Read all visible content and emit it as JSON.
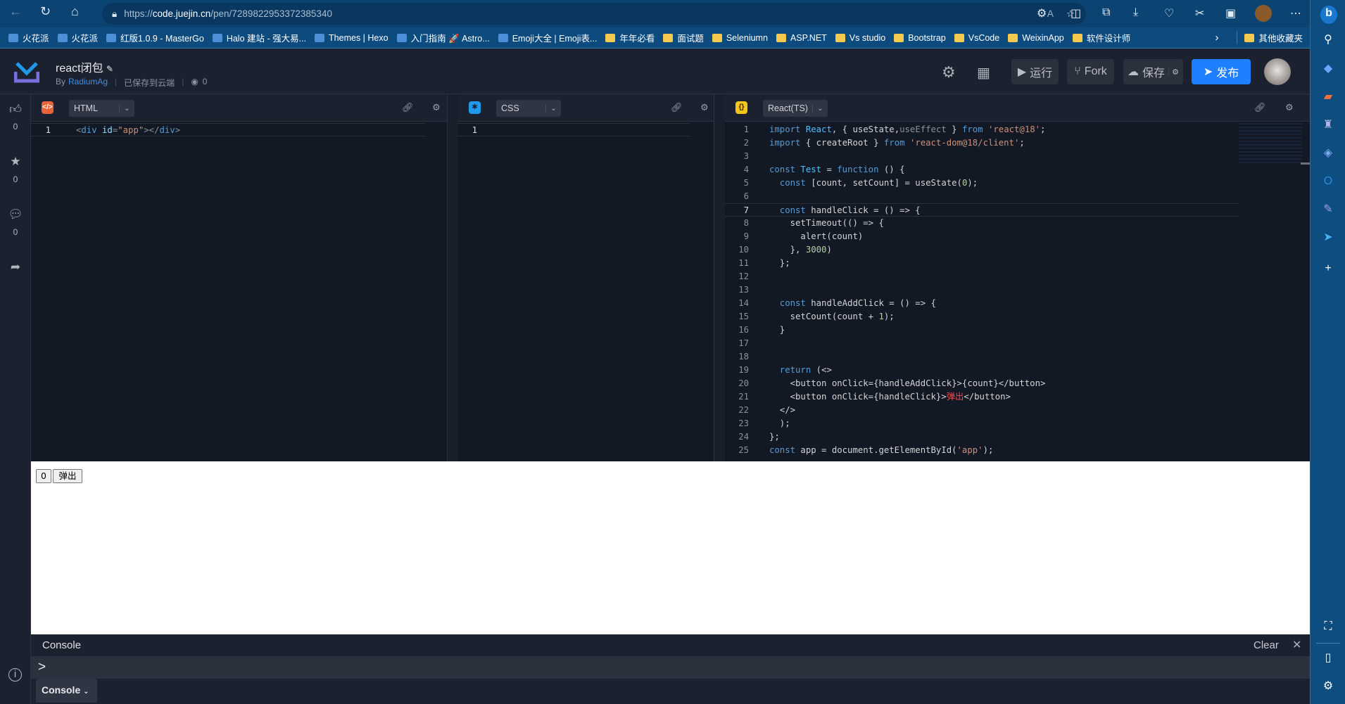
{
  "browser": {
    "url_prefix": "https://",
    "url_host": "code.juejin.cn",
    "url_path": "/pen/7289822953372385340",
    "bookmarks": [
      {
        "label": "火花派",
        "icon": "site"
      },
      {
        "label": "火花派",
        "icon": "site"
      },
      {
        "label": "红版1.0.9 - MasterGo",
        "icon": "site"
      },
      {
        "label": "Halo 建站 - 强大易...",
        "icon": "site"
      },
      {
        "label": "Themes | Hexo",
        "icon": "site"
      },
      {
        "label": "入门指南 🚀 Astro...",
        "icon": "site"
      },
      {
        "label": "Emoji大全 | Emoji表...",
        "icon": "site"
      },
      {
        "label": "年年必看",
        "icon": "folder"
      },
      {
        "label": "面试题",
        "icon": "folder"
      },
      {
        "label": "Seleniumn",
        "icon": "folder"
      },
      {
        "label": "ASP.NET",
        "icon": "folder"
      },
      {
        "label": "Vs studio",
        "icon": "folder"
      },
      {
        "label": "Bootstrap",
        "icon": "folder"
      },
      {
        "label": "VsCode",
        "icon": "folder"
      },
      {
        "label": "WeixinApp",
        "icon": "folder"
      },
      {
        "label": "软件设计师",
        "icon": "folder"
      }
    ],
    "other_bookmarks": "其他收藏夹"
  },
  "header": {
    "title": "react闭包",
    "by": "By",
    "author": "RadiumAg",
    "save_status": "已保存到云端",
    "views": "0",
    "run_label": "运行",
    "fork_label": "Fork",
    "save_label": "保存",
    "publish_label": "发布",
    "accent": "#1e80ff"
  },
  "rail": {
    "likes": "0",
    "stars": "0",
    "comments": "0"
  },
  "editors": {
    "html": {
      "lang": "HTML",
      "color": "#e8633a",
      "lines": [
        [
          [
            "<",
            "d"
          ],
          [
            "div",
            "tag"
          ],
          [
            " ",
            "p"
          ],
          [
            "id",
            "at"
          ],
          [
            "=",
            "d"
          ],
          [
            "\"app\"",
            "s"
          ],
          [
            "></",
            "d"
          ],
          [
            "div",
            "tag"
          ],
          [
            ">",
            "d"
          ]
        ]
      ]
    },
    "css": {
      "lang": "CSS",
      "color": "#1e9be8",
      "lines": [
        []
      ]
    },
    "js": {
      "lang": "React(TS)",
      "color": "#f5c518",
      "lines": [
        [
          [
            "import ",
            "k"
          ],
          [
            "React",
            "t"
          ],
          [
            ", { useState,",
            "p"
          ],
          [
            "useEffect",
            "d"
          ],
          [
            " } ",
            "p"
          ],
          [
            "from ",
            "k"
          ],
          [
            "'react@18'",
            "s"
          ],
          [
            ";",
            "p"
          ]
        ],
        [
          [
            "import ",
            "k"
          ],
          [
            "{ createRoot } ",
            "p"
          ],
          [
            "from ",
            "k"
          ],
          [
            "'react-dom@18/client'",
            "s"
          ],
          [
            ";",
            "p"
          ]
        ],
        [],
        [
          [
            "const ",
            "k"
          ],
          [
            "Test",
            "t"
          ],
          [
            " = ",
            "p"
          ],
          [
            "function",
            "k"
          ],
          [
            " () {",
            "p"
          ]
        ],
        [
          [
            "  const ",
            "k"
          ],
          [
            "[count, setCount] = useState(",
            "p"
          ],
          [
            "0",
            "n"
          ],
          [
            ");",
            "p"
          ]
        ],
        [],
        [
          [
            "  const ",
            "k"
          ],
          [
            "handleClick = () => {",
            "p"
          ]
        ],
        [
          [
            "    setTimeout(() => {",
            "p"
          ]
        ],
        [
          [
            "      alert(count)",
            "p"
          ]
        ],
        [
          [
            "    }, ",
            "p"
          ],
          [
            "3000",
            "n"
          ],
          [
            ")",
            "p"
          ]
        ],
        [
          [
            "  };",
            "p"
          ]
        ],
        [],
        [],
        [
          [
            "  const ",
            "k"
          ],
          [
            "handleAddClick = () => {",
            "p"
          ]
        ],
        [
          [
            "    setCount(count + ",
            "p"
          ],
          [
            "1",
            "n"
          ],
          [
            ");",
            "p"
          ]
        ],
        [
          [
            "  }",
            "p"
          ]
        ],
        [],
        [],
        [
          [
            "  return ",
            "k"
          ],
          [
            "(<>",
            "p"
          ]
        ],
        [
          [
            "    <button onClick={handleAddClick}>{count}</button>",
            "p"
          ]
        ],
        [
          [
            "    <button onClick={handleClick}>",
            "p"
          ],
          [
            "弹出",
            "r"
          ],
          [
            "</button>",
            "p"
          ]
        ],
        [
          [
            "  </>",
            "p"
          ]
        ],
        [
          [
            "  );",
            "p"
          ]
        ],
        [
          [
            "};",
            "p"
          ]
        ],
        [
          [
            "const ",
            "k"
          ],
          [
            "app = document.getElementById(",
            "p"
          ],
          [
            "'app'",
            "s"
          ],
          [
            ");",
            "p"
          ]
        ]
      ]
    }
  },
  "preview": {
    "count_button": "0",
    "popup_button": "弹出"
  },
  "console": {
    "title": "Console",
    "clear": "Clear",
    "prompt": ">",
    "tab": "Console"
  }
}
